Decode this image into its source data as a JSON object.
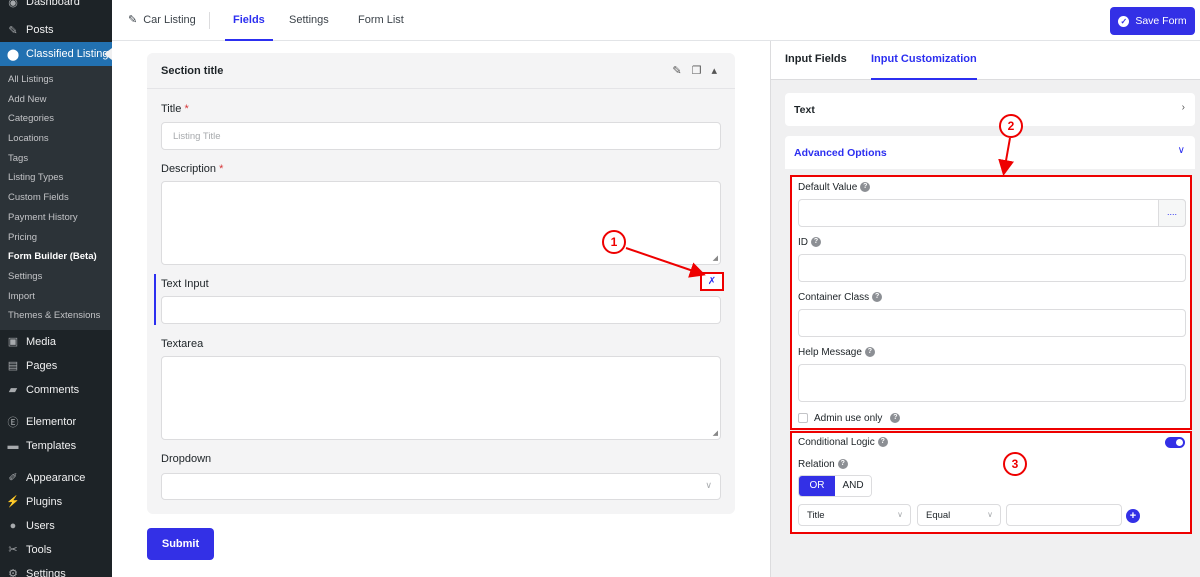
{
  "sidebar": {
    "top_item": "Dashboard",
    "items_before": [
      {
        "label": "Posts",
        "icon": "pin-icon"
      }
    ],
    "active": {
      "label": "Classified Listing",
      "icon": "map-marker-icon"
    },
    "submenu": [
      "All Listings",
      "Add New",
      "Categories",
      "Locations",
      "Tags",
      "Listing Types",
      "Custom Fields",
      "Payment History",
      "Pricing",
      "Form Builder (Beta)",
      "Settings",
      "Import",
      "Themes & Extensions"
    ],
    "current_sub": "Form Builder (Beta)",
    "items_after": [
      {
        "label": "Media",
        "icon": "media-icon"
      },
      {
        "label": "Pages",
        "icon": "pages-icon"
      },
      {
        "label": "Comments",
        "icon": "comments-icon"
      },
      {
        "label": "Elementor",
        "icon": "elementor-icon"
      },
      {
        "label": "Templates",
        "icon": "folder-icon"
      },
      {
        "label": "Appearance",
        "icon": "brush-icon"
      },
      {
        "label": "Plugins",
        "icon": "plug-icon"
      },
      {
        "label": "Users",
        "icon": "user-icon"
      },
      {
        "label": "Tools",
        "icon": "wrench-icon"
      },
      {
        "label": "Settings",
        "icon": "settings-icon"
      }
    ]
  },
  "topbar": {
    "form_name": "Car Listing",
    "tabs": [
      "Fields",
      "Settings",
      "Form List"
    ],
    "active_tab": "Fields",
    "save_label": "Save Form"
  },
  "builder": {
    "section_title": "Section title",
    "fields": {
      "title_label": "Title",
      "title_placeholder": "Listing Title",
      "description_label": "Description",
      "text_input_label": "Text Input",
      "textarea_label": "Textarea",
      "dropdown_label": "Dropdown"
    },
    "required_mark": "*",
    "submit_label": "Submit"
  },
  "panel": {
    "tabs": [
      "Input Fields",
      "Input Customization"
    ],
    "active_tab": "Input Customization",
    "accordion_text": "Text",
    "accordion_advanced": "Advanced Options",
    "default_value_label": "Default Value",
    "dots_label": "....",
    "id_label": "ID",
    "container_class_label": "Container Class",
    "help_message_label": "Help Message",
    "admin_only_label": "Admin use only",
    "conditional_logic_label": "Conditional Logic",
    "conditional_logic_enabled": true,
    "relation_label": "Relation",
    "relation_options": [
      "OR",
      "AND"
    ],
    "relation_selected": "OR",
    "condition_field": "Title",
    "condition_operator": "Equal",
    "help_glyph": "?"
  },
  "annotations": [
    "1",
    "2",
    "3"
  ],
  "colors": {
    "accent": "#2c2ff0",
    "button": "#3330e6",
    "annotation": "#e00000",
    "sidebar": "#1d2327",
    "sidebar_active": "#2271b1"
  }
}
